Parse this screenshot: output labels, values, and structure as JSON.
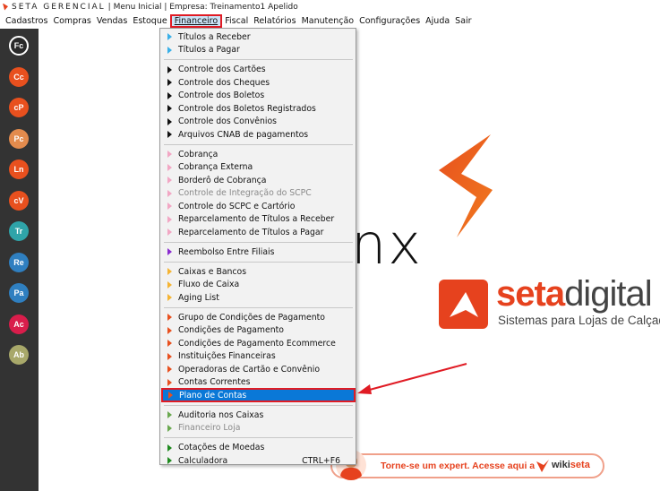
{
  "title_bar": {
    "brand": "SETA GERENCIAL",
    "rest": "| Menu Inicial | Empresa: Treinamento1 Apelido"
  },
  "menubar": [
    {
      "key": "cadastros",
      "label": "Cadastros"
    },
    {
      "key": "compras",
      "label": "Compras"
    },
    {
      "key": "vendas",
      "label": "Vendas"
    },
    {
      "key": "estoque",
      "label": "Estoque"
    },
    {
      "key": "financeiro",
      "label": "Financeiro",
      "active": true
    },
    {
      "key": "fiscal",
      "label": "Fiscal"
    },
    {
      "key": "relatorios",
      "label": "Relatórios"
    },
    {
      "key": "manutencao",
      "label": "Manutenção"
    },
    {
      "key": "configuracoes",
      "label": "Configurações"
    },
    {
      "key": "ajuda",
      "label": "Ajuda"
    },
    {
      "key": "sair",
      "label": "Sair"
    }
  ],
  "sidebar": [
    {
      "label": "Fc",
      "color": "#2a2a2a",
      "ring": "#ffffff"
    },
    {
      "label": "Cc",
      "color": "#e8501e"
    },
    {
      "label": "cP",
      "color": "#e8501e"
    },
    {
      "label": "Pc",
      "color": "#e38b4d"
    },
    {
      "label": "Ln",
      "color": "#e8501e"
    },
    {
      "label": "cV",
      "color": "#e8501e"
    },
    {
      "label": "Tr",
      "color": "#2fa4a9"
    },
    {
      "label": "Re",
      "color": "#2f7fc0"
    },
    {
      "label": "Pa",
      "color": "#2f7fc0"
    },
    {
      "label": "Ac",
      "color": "#d91d4b"
    },
    {
      "label": "Ab",
      "color": "#a8a86a"
    }
  ],
  "dropdown": {
    "items": [
      {
        "type": "item",
        "label": "Títulos a Receber",
        "arrow": "#3ab0e8"
      },
      {
        "type": "item",
        "label": "Títulos a Pagar",
        "arrow": "#3ab0e8"
      },
      {
        "type": "sep"
      },
      {
        "type": "item",
        "label": "Controle dos Cartões",
        "arrow": "#111111"
      },
      {
        "type": "item",
        "label": "Controle dos Cheques",
        "arrow": "#111111"
      },
      {
        "type": "item",
        "label": "Controle dos Boletos",
        "arrow": "#111111"
      },
      {
        "type": "item",
        "label": "Controle dos Boletos Registrados",
        "arrow": "#111111"
      },
      {
        "type": "item",
        "label": "Controle dos Convênios",
        "arrow": "#111111"
      },
      {
        "type": "item",
        "label": "Arquivos CNAB de pagamentos",
        "arrow": "#111111"
      },
      {
        "type": "sep"
      },
      {
        "type": "item",
        "label": "Cobrança",
        "arrow": "#f2a7c4"
      },
      {
        "type": "item",
        "label": "Cobrança Externa",
        "arrow": "#f2a7c4"
      },
      {
        "type": "item",
        "label": "Borderô de Cobrança",
        "arrow": "#f2a7c4"
      },
      {
        "type": "item",
        "label": "Controle de Integração do SCPC",
        "arrow": "#f2a7c4",
        "disabled": true
      },
      {
        "type": "item",
        "label": "Controle do SCPC e Cartório",
        "arrow": "#f2a7c4"
      },
      {
        "type": "item",
        "label": "Reparcelamento de Títulos a Receber",
        "arrow": "#f2a7c4"
      },
      {
        "type": "item",
        "label": "Reparcelamento de Títulos a Pagar",
        "arrow": "#f2a7c4"
      },
      {
        "type": "sep"
      },
      {
        "type": "item",
        "label": "Reembolso Entre Filiais",
        "arrow": "#8a2bd0"
      },
      {
        "type": "sep"
      },
      {
        "type": "item",
        "label": "Caixas e Bancos",
        "arrow": "#f5b433"
      },
      {
        "type": "item",
        "label": "Fluxo de Caixa",
        "arrow": "#f5b433"
      },
      {
        "type": "item",
        "label": "Aging List",
        "arrow": "#f5b433"
      },
      {
        "type": "sep"
      },
      {
        "type": "item",
        "label": "Grupo de Condições de Pagamento",
        "arrow": "#e8501e"
      },
      {
        "type": "item",
        "label": "Condições de Pagamento",
        "arrow": "#e8501e"
      },
      {
        "type": "item",
        "label": "Condições de Pagamento Ecommerce",
        "arrow": "#e8501e"
      },
      {
        "type": "item",
        "label": "Instituições Financeiras",
        "arrow": "#e8501e"
      },
      {
        "type": "item",
        "label": "Operadoras de Cartão e Convênio",
        "arrow": "#e8501e"
      },
      {
        "type": "item",
        "label": "Contas Correntes",
        "arrow": "#e8501e"
      },
      {
        "type": "item",
        "label": "Plano de Contas",
        "arrow": "#e8501e",
        "selected": true
      },
      {
        "type": "sep"
      },
      {
        "type": "item",
        "label": "Auditoria nos Caixas",
        "arrow": "#6aa84f"
      },
      {
        "type": "item",
        "label": "Financeiro Loja",
        "arrow": "#6aa84f",
        "disabled": true
      },
      {
        "type": "sep"
      },
      {
        "type": "item",
        "label": "Cotações de Moedas",
        "arrow": "#1f8a1f"
      },
      {
        "type": "item",
        "label": "Calculadora",
        "arrow": "#1f8a1f",
        "shortcut": "CTRL+F6"
      }
    ]
  },
  "background": {
    "nx_text": "nx",
    "brand_seta": "seta",
    "brand_digital": "digital",
    "brand_sub": "Sistemas para Lojas de Calçados"
  },
  "wiki_banner": {
    "text": "Torne-se um expert. Acesse aqui a",
    "brand_prefix": "wiki",
    "brand_suffix": "seta"
  },
  "colors": {
    "accent": "#e6421e",
    "selection": "#0a78d7",
    "highlight_box": "#e01b24"
  }
}
